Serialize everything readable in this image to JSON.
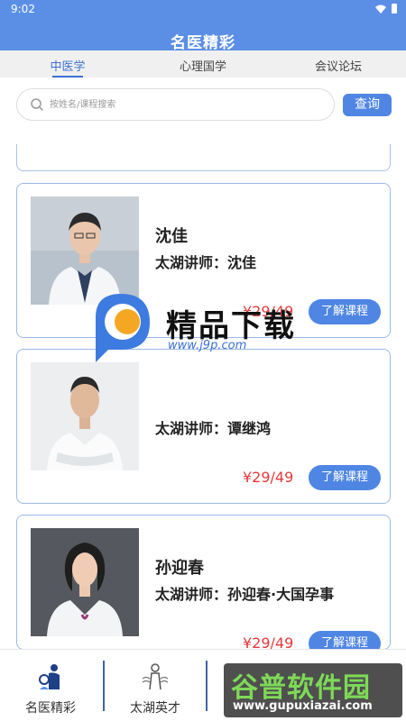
{
  "status_bar": {
    "time": "9:02"
  },
  "header": {
    "title": "名医精彩"
  },
  "tabs": [
    {
      "label": "中医学",
      "active": true
    },
    {
      "label": "心理国学",
      "active": false
    },
    {
      "label": "会议论坛",
      "active": false
    }
  ],
  "search": {
    "placeholder": "按姓名/课程搜索",
    "button_label": "查询"
  },
  "courses": [
    {
      "name": "沈佳",
      "lecturer": "太湖讲师：沈佳",
      "price": "¥29/49",
      "button_label": "了解课程"
    },
    {
      "name": "",
      "lecturer": "太湖讲师：谭继鸿",
      "price": "¥29/49",
      "button_label": "了解课程"
    },
    {
      "name": "孙迎春",
      "lecturer": "太湖讲师：孙迎春·大国孕事",
      "price": "¥29/49",
      "button_label": "了解课程"
    }
  ],
  "bottom_nav": [
    {
      "label": "名医精彩",
      "icon": "doctor-icon"
    },
    {
      "label": "太湖英才",
      "icon": "talent-icon"
    }
  ],
  "watermarks": {
    "center_text": "精品下载",
    "center_url": "www.j9p.com",
    "bottom_text": "谷普软件园",
    "bottom_url": "www.gupuxiazai.com"
  },
  "colors": {
    "primary": "#5b8fe6",
    "button": "#4f86e3",
    "price": "#e33a3a",
    "card_border": "#9ab9e8"
  }
}
